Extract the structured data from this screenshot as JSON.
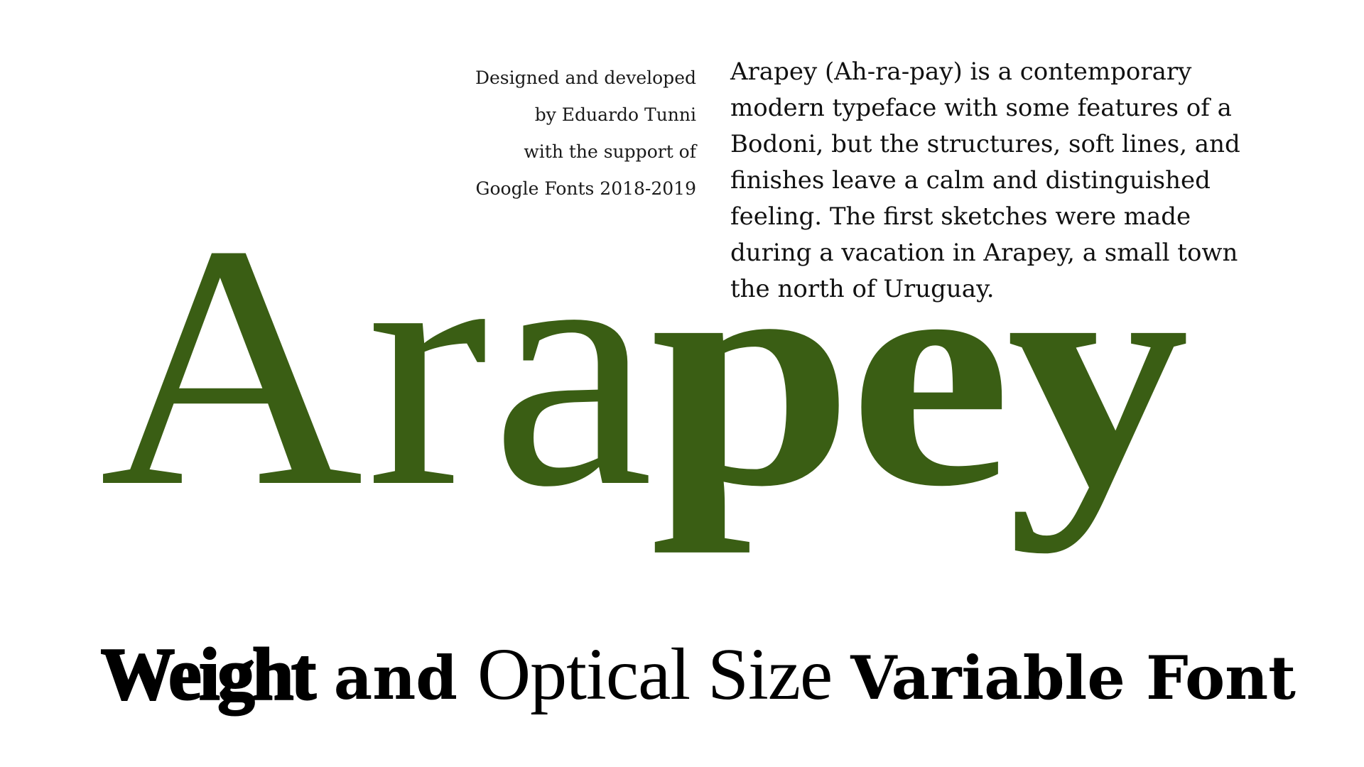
{
  "credits": {
    "lines": [
      "Designed and developed",
      "by Eduardo Tunni",
      "with the support of",
      "Google Fonts 2018-2019"
    ]
  },
  "description": {
    "lines": [
      "Arapey (Ah-ra-pay) is a contemporary",
      "modern typeface with some features of a",
      "Bodoni, but the structures, soft lines, and",
      "finishes leave a calm and distinguished",
      "feeling. The first sketches were made",
      "during a vacation in Arapey, a small town",
      "the north of Uruguay."
    ]
  },
  "wordmark": {
    "light_part": "Ara",
    "heavy_part": "pey",
    "color": "#3a5e14"
  },
  "tagline": {
    "word1": "Weight",
    "word2": "and",
    "word3": "Optical Size",
    "word4": "Variable Font"
  }
}
